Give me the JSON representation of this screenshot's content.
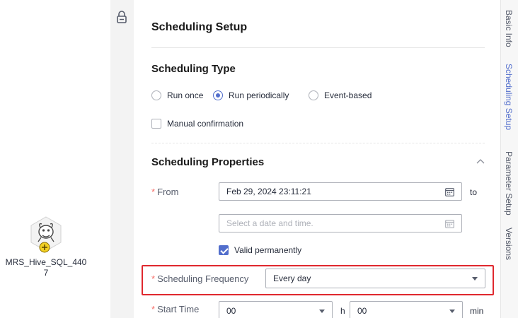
{
  "canvas": {
    "node": {
      "label": "MRS_Hive_SQL_440\n7",
      "icon": "hive-bee-icon",
      "badge_icon": "add-circle-icon"
    },
    "lock_icon": "lock-icon"
  },
  "panel": {
    "title": "Scheduling Setup",
    "scheduling_type": {
      "heading": "Scheduling Type",
      "options": [
        {
          "label": "Run once",
          "selected": false
        },
        {
          "label": "Run periodically",
          "selected": true
        },
        {
          "label": "Event-based",
          "selected": false
        }
      ],
      "manual_confirmation": {
        "label": "Manual confirmation",
        "checked": false
      }
    },
    "scheduling_properties": {
      "heading": "Scheduling Properties",
      "from_label": "From",
      "from_value": "Feb 29, 2024 23:11:21",
      "to_label": "to",
      "end_placeholder": "Select a date and time.",
      "valid_permanently": {
        "label": "Valid permanently",
        "checked": true
      },
      "frequency_label": "Scheduling Frequency",
      "frequency_value": "Every day",
      "start_time_label": "Start Time",
      "start_hour": "00",
      "hour_unit": "h",
      "start_minute": "00",
      "minute_unit": "min"
    }
  },
  "side_tabs": [
    "Basic Info",
    "Scheduling Setup",
    "Parameter Setup",
    "Versions"
  ],
  "colors": {
    "accent": "#526ecc",
    "required": "#f66f6a",
    "highlight": "#e0282e",
    "node_badge": "#f2d024"
  }
}
